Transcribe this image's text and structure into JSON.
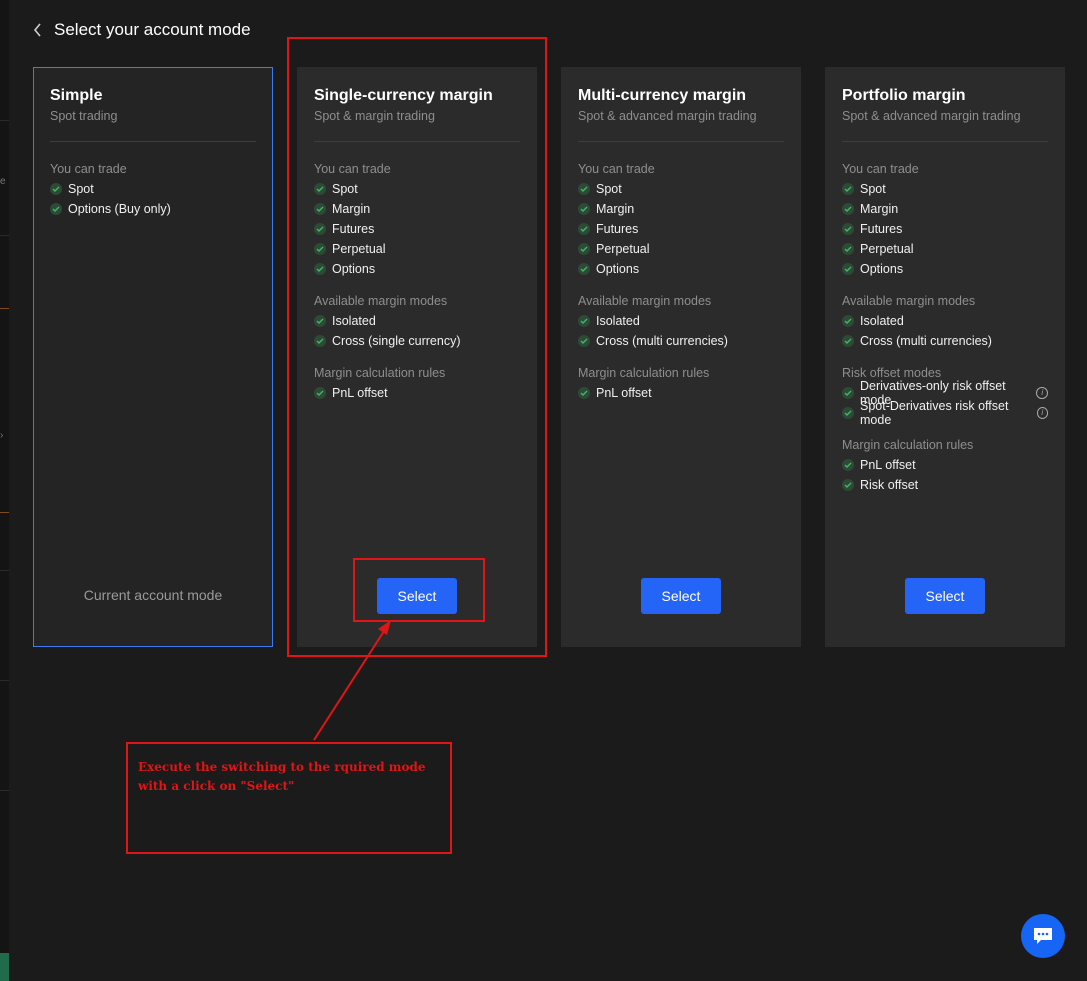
{
  "header": {
    "title": "Select your account mode"
  },
  "cards": [
    {
      "title": "Simple",
      "subtitle": "Spot trading",
      "sections": [
        {
          "label": "You can trade",
          "items": [
            "Spot",
            "Options (Buy only)"
          ]
        }
      ],
      "current_label": "Current account mode"
    },
    {
      "title": "Single-currency margin",
      "subtitle": "Spot & margin trading",
      "sections": [
        {
          "label": "You can trade",
          "items": [
            "Spot",
            "Margin",
            "Futures",
            "Perpetual",
            "Options"
          ]
        },
        {
          "label": "Available margin modes",
          "items": [
            "Isolated",
            "Cross (single currency)"
          ]
        },
        {
          "label": "Margin calculation rules",
          "items": [
            "PnL offset"
          ]
        }
      ],
      "button_label": "Select"
    },
    {
      "title": "Multi-currency margin",
      "subtitle": "Spot & advanced margin trading",
      "sections": [
        {
          "label": "You can trade",
          "items": [
            "Spot",
            "Margin",
            "Futures",
            "Perpetual",
            "Options"
          ]
        },
        {
          "label": "Available margin modes",
          "items": [
            "Isolated",
            "Cross (multi currencies)"
          ]
        },
        {
          "label": "Margin calculation rules",
          "items": [
            "PnL offset"
          ]
        }
      ],
      "button_label": "Select"
    },
    {
      "title": "Portfolio margin",
      "subtitle": "Spot & advanced margin trading",
      "sections": [
        {
          "label": "You can trade",
          "items": [
            "Spot",
            "Margin",
            "Futures",
            "Perpetual",
            "Options"
          ]
        },
        {
          "label": "Available margin modes",
          "items": [
            "Isolated",
            "Cross (multi currencies)"
          ]
        },
        {
          "label": "Risk offset modes",
          "items": [
            "Derivatives-only risk offset mode",
            "Spot-Derivatives risk offset mode"
          ]
        },
        {
          "label": "Margin calculation rules",
          "items": [
            "PnL offset",
            "Risk offset"
          ]
        }
      ],
      "button_label": "Select"
    }
  ],
  "annotation": {
    "line1": "Execute the switching to the rquired mode",
    "line2": "with a click on \"Select\""
  },
  "colors": {
    "accent": "#2465f7",
    "current_border": "#3d7cf0",
    "annotation": "#e01515",
    "check": "#3fb96a"
  },
  "icons": {
    "back": "chevron-left-icon",
    "check": "check-circle-icon",
    "info": "info-icon",
    "chat": "chat-bubble-icon"
  }
}
